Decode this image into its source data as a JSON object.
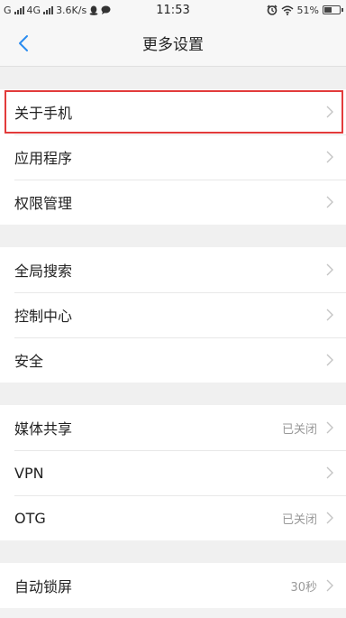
{
  "status_bar": {
    "left_text_1": "G",
    "left_text_2": "4G",
    "speed": "3.6K/s",
    "time": "11:53",
    "battery_percent": "51%",
    "battery_level": 0.51,
    "icons": [
      "signal-icon",
      "qq-icon",
      "chat-bubble-icon",
      "alarm-icon",
      "wifi-icon",
      "battery-icon"
    ]
  },
  "header": {
    "title": "更多设置",
    "back_icon": "chevron-left-icon",
    "accent_color": "#2a8cf0"
  },
  "groups": [
    {
      "items": [
        {
          "label": "关于手机",
          "value": "",
          "highlighted": true
        },
        {
          "label": "应用程序",
          "value": ""
        },
        {
          "label": "权限管理",
          "value": ""
        }
      ]
    },
    {
      "items": [
        {
          "label": "全局搜索",
          "value": ""
        },
        {
          "label": "控制中心",
          "value": ""
        },
        {
          "label": "安全",
          "value": ""
        }
      ]
    },
    {
      "items": [
        {
          "label": "媒体共享",
          "value": "已关闭"
        },
        {
          "label": "VPN",
          "value": ""
        },
        {
          "label": "OTG",
          "value": "已关闭"
        }
      ]
    },
    {
      "items": [
        {
          "label": "自动锁屏",
          "value": "30秒"
        }
      ]
    }
  ],
  "highlight_color": "#e23b3b"
}
